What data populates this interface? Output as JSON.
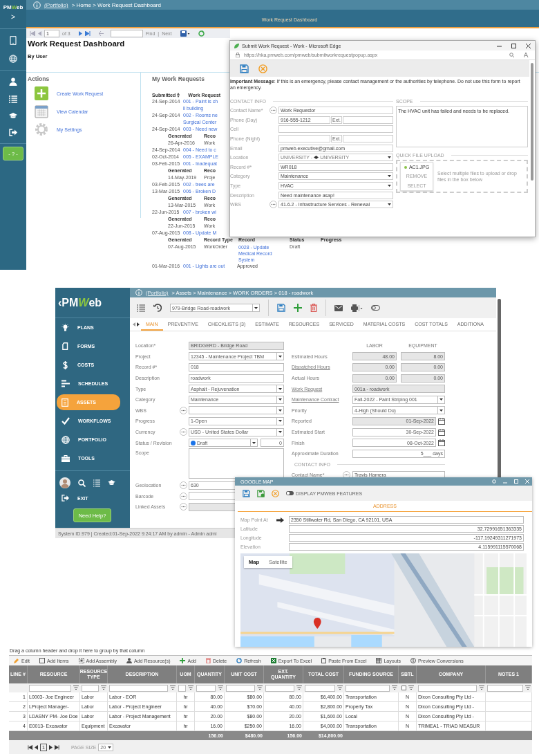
{
  "top": {
    "sidebar": {
      "logo": {
        "lead": "PM",
        "mark": "W",
        "tail": "eb"
      },
      "expand": ">",
      "help": "- ? -"
    },
    "breadcrumb": {
      "link": "(Portfolio)",
      "trail": "> Home > Work Request Dashboard"
    },
    "banner": "Work Request Dashboard",
    "report_toolbar": {
      "page": "1",
      "of": "of 3",
      "find": "Find",
      "separator": "|",
      "next": "Next"
    },
    "title": "Work Request Dashboard",
    "subtitle": "By User",
    "actions": {
      "title": "Actions",
      "items": [
        {
          "kind": "create",
          "label": "Create Work Request"
        },
        {
          "kind": "calendar",
          "label": "View Calendar"
        },
        {
          "kind": "settings",
          "label": "My Settings"
        }
      ]
    },
    "requests": {
      "title": "My Work Requests",
      "columns": [
        "Submitted",
        "Work Request"
      ],
      "rows": [
        {
          "kind": "request",
          "submitted": "24-Sep-2014",
          "lines": [
            "001 - Paint is ch",
            "ll building"
          ]
        },
        {
          "kind": "request",
          "submitted": "24-Sep-2014",
          "lines": [
            "002 - Rooms ne",
            "Surgical Center"
          ]
        },
        {
          "kind": "request",
          "submitted": "24-Sep-2014",
          "lines": [
            "003 - Need new"
          ]
        },
        {
          "kind": "generated",
          "columns": [
            "Generated",
            "Reco"
          ],
          "cells": [
            "26-Apr-2016",
            "Work"
          ]
        },
        {
          "kind": "request",
          "submitted": "24-Sep-2014",
          "lines": [
            "004 - Need to c"
          ]
        },
        {
          "kind": "request",
          "submitted": "02-Oct-2014",
          "lines": [
            "005 - EXAMPLE"
          ]
        },
        {
          "kind": "request",
          "submitted": "03-Feb-2015",
          "lines": [
            "001 - Inadequat"
          ]
        },
        {
          "kind": "generated",
          "columns": [
            "Generated",
            "Reco"
          ],
          "cells": [
            "14-May-2019",
            "Proje"
          ]
        },
        {
          "kind": "request",
          "submitted": "03-Feb-2015",
          "lines": [
            "002 - trees are"
          ]
        },
        {
          "kind": "request",
          "submitted": "13-Mar-2015",
          "lines": [
            "006 - Broken D"
          ]
        },
        {
          "kind": "generated",
          "columns": [
            "Generated",
            "Reco"
          ],
          "cells": [
            "13-Mar-2015",
            "Work"
          ]
        },
        {
          "kind": "request",
          "submitted": "22-Jun-2015",
          "lines": [
            "007 - broken wi"
          ]
        },
        {
          "kind": "generated",
          "columns": [
            "Generated",
            "Reco"
          ],
          "cells": [
            "22-Jun-2015",
            "Work"
          ]
        },
        {
          "kind": "request",
          "submitted": "07-Aug-2015",
          "lines": [
            "008 - Update M"
          ]
        },
        {
          "kind": "generated",
          "columns": [
            "Generated",
            "Record Type",
            "Record",
            "Status",
            "Progress"
          ],
          "cells": [
            "07-Aug-2015",
            "WorkOrder",
            "0028 - Update Medical Record System",
            "Draft"
          ]
        },
        {
          "kind": "request",
          "submitted": "01-Mar-2016",
          "lines": [
            "001 - Lights are out"
          ],
          "status": "Approved"
        }
      ]
    },
    "popup": {
      "title": "Submit Work Request - Work - Microsoft Edge",
      "url": "https://hka.pmweb.com/pmweb/submitworkrequestpopup.aspx",
      "message": "**Important Message**: If this is an emergency, please contact management or the authorities by telephone. Do not use this form to report an emergency.",
      "contact_title": "CONTACT INFO",
      "fields": [
        {
          "label": "Contact Name*",
          "kind": "text",
          "value": "Work Requestor",
          "picker": true
        },
        {
          "label": "Phone (Day)",
          "kind": "phone",
          "value": "916-555-1212",
          "ext": "Ext.",
          "picker": false
        },
        {
          "label": "Cell",
          "kind": "text",
          "picker": false
        },
        {
          "label": "Phone (Night)",
          "kind": "phone",
          "ext": "Ext.",
          "picker": false
        },
        {
          "label": "Email",
          "kind": "text",
          "value": "pmweb.executive@gmail.com",
          "picker": false
        },
        {
          "label": "Location",
          "kind": "location",
          "value": "UNIVERSITY -",
          "site": "UNIVERSITY",
          "picker": false
        },
        {
          "label": "Record #*",
          "kind": "text",
          "value": "WR018",
          "picker": false
        },
        {
          "label": "Category",
          "kind": "select",
          "value": "Maintenance",
          "picker": false
        },
        {
          "label": "Type",
          "kind": "select",
          "value": "HVAC",
          "picker": false
        },
        {
          "label": "Description",
          "kind": "text",
          "value": "Need maintenance asap!",
          "picker": false
        },
        {
          "label": "WBS",
          "kind": "select",
          "value": "41.6.2 - Infrastructure Services - Renewal",
          "picker": true
        }
      ],
      "scope_title": "SCOPE",
      "scope": "The HVAC unit has failed and needs to be replaced.",
      "upload_title": "QUICK FILE UPLOAD",
      "file": {
        "name": "AC1.JPG",
        "remove": "REMOVE",
        "select": "SELECT"
      },
      "drop_hint": "Select multiple files to upload or drop files in the box below"
    }
  },
  "middle": {
    "logo": {
      "back": "‹",
      "lead": "PM",
      "mark": "W",
      "tail": "eb"
    },
    "nav": [
      {
        "kind": "plans",
        "label": "PLANS",
        "selected": false
      },
      {
        "kind": "forms",
        "label": "FORMS",
        "selected": false
      },
      {
        "kind": "costs",
        "label": "COSTS",
        "selected": false
      },
      {
        "kind": "schedules",
        "label": "SCHEDULES",
        "selected": false
      },
      {
        "kind": "assets",
        "label": "ASSETS",
        "selected": true
      },
      {
        "kind": "workflows",
        "label": "WORKFLOWS",
        "selected": false
      },
      {
        "kind": "portfolio",
        "label": "PORTFOLIO",
        "selected": false
      },
      {
        "kind": "tools",
        "label": "TOOLS",
        "selected": false
      }
    ],
    "exit": "EXIT",
    "help": "Need Help?",
    "breadcrumb": {
      "link": "(Portfolio)",
      "trail": "> Assets > Maintenance > WORK ORDERS > 018 - roadwork"
    },
    "record": "979-Bridge Road-roadwork",
    "tabs": [
      {
        "label": "MAIN",
        "selected": true
      },
      {
        "label": "PREVENTIVE",
        "selected": false
      },
      {
        "label": "CHECKLISTS (3)",
        "selected": false
      },
      {
        "label": "ESTIMATE",
        "selected": false
      },
      {
        "label": "RESOURCES",
        "selected": false
      },
      {
        "label": "SERVICED",
        "selected": false
      },
      {
        "label": "MATERIAL COSTS",
        "selected": false
      },
      {
        "label": "COST TOTALS",
        "selected": false
      },
      {
        "label": "ADDITIONA",
        "selected": false
      }
    ],
    "left_fields": [
      {
        "label": "Location*",
        "kind": "text",
        "value": "BRIDGERD - Bridge Road",
        "readonly": true,
        "picker": false
      },
      {
        "label": "Project",
        "kind": "select",
        "value": "12345 - Maintenance Project TBM",
        "readonly": false,
        "picker": false
      },
      {
        "label": "Record #*",
        "kind": "text",
        "value": "018",
        "readonly": false,
        "picker": false
      },
      {
        "label": "Description",
        "kind": "text",
        "value": "roadwork",
        "readonly": false,
        "picker": false
      },
      {
        "label": "Type",
        "kind": "select",
        "value": "Asphalt - Rejuvenation",
        "readonly": false,
        "picker": false
      },
      {
        "label": "Category",
        "kind": "select",
        "value": "Maintenance",
        "readonly": false,
        "picker": false
      },
      {
        "label": "WBS",
        "kind": "select",
        "readonly": false,
        "picker": true
      },
      {
        "label": "Progress",
        "kind": "select",
        "value": "1-Open",
        "readonly": false,
        "picker": false
      },
      {
        "label": "Currency",
        "kind": "select",
        "value": "USD - United States Dollar",
        "readonly": false,
        "picker": true
      },
      {
        "label": "Status / Revision",
        "kind": "status",
        "value": "Draft",
        "revision": "0",
        "readonly": false,
        "picker": false
      },
      {
        "label": "Scope",
        "kind": "textarea",
        "readonly": false,
        "picker": false
      },
      {
        "label": "Geolocation",
        "kind": "text",
        "value": "630",
        "readonly": false,
        "picker": true
      },
      {
        "label": "Barcode",
        "kind": "text",
        "readonly": false,
        "picker": true
      },
      {
        "label": "Linked Assets",
        "kind": "text",
        "readonly": true,
        "picker": true
      }
    ],
    "right_header": [
      "LABOR",
      "EQUIPMENT"
    ],
    "right_fields": [
      {
        "label": "Estimated Hours",
        "kind": "pair",
        "values": [
          "48.00",
          "8.00"
        ],
        "link": false,
        "readonly": true,
        "picker": false
      },
      {
        "label": "Dispatched Hours",
        "kind": "pair",
        "values": [
          "0.00",
          "0.00"
        ],
        "link": true,
        "readonly": true,
        "picker": false
      },
      {
        "label": "Actual Hours",
        "kind": "pair",
        "values": [
          "0.00",
          "0.00"
        ],
        "link": false,
        "readonly": true,
        "picker": false
      },
      {
        "label": "Work Request",
        "kind": "text",
        "value": "001a - roadwork",
        "link": true,
        "readonly": true,
        "picker": false
      },
      {
        "label": "Maintenance Contract",
        "kind": "select",
        "value": "Fall-2022 - Paint Striping 001",
        "link": true,
        "readonly": false,
        "picker": false
      },
      {
        "label": "Priority",
        "kind": "select",
        "value": "4-High (Should Do)",
        "link": false,
        "readonly": false,
        "picker": false
      },
      {
        "label": "Reported",
        "kind": "date",
        "value": "01-Sep-2022",
        "link": false,
        "readonly": true,
        "picker": false
      },
      {
        "label": "Estimated Start",
        "kind": "date",
        "value": "30-Sep-2022",
        "link": false,
        "readonly": false,
        "picker": false
      },
      {
        "label": "Finish",
        "kind": "date",
        "value": "08-Oct-2022",
        "link": false,
        "readonly": false,
        "picker": false
      },
      {
        "label": "Approximate Duration",
        "kind": "duration",
        "value": "5___ days",
        "link": false,
        "readonly": false,
        "picker": false
      },
      {
        "label": "CONTACT INFO",
        "kind": "section"
      },
      {
        "label": "Contact Name*",
        "kind": "text",
        "value": "Travis Hamera",
        "link": false,
        "readonly": false,
        "picker": true
      }
    ],
    "status_bar": "System ID:979 | Created:01-Sep-2022 9:24:17 AM by admin - Admin admi"
  },
  "map": {
    "title": "GOOGLE MAP",
    "toggle": {
      "label": "DISPLAY PMWEB FEATURES",
      "on": false
    },
    "tabs": [
      {
        "label": "ADDRESS",
        "selected": true
      }
    ],
    "fields": [
      {
        "label": "Map Point At",
        "kind": "address",
        "value": "2350 Stillwater Rd, San Diego, CA 92101, USA"
      },
      {
        "label": "Latitude",
        "kind": "number",
        "value": "32.72991651363335"
      },
      {
        "label": "Longitude",
        "kind": "number",
        "value": "-117.19249311271973"
      },
      {
        "label": "Elevation",
        "kind": "number",
        "value": "4.115991115570068"
      }
    ],
    "map_types": [
      {
        "label": "Map",
        "selected": true
      },
      {
        "label": "Satellite",
        "selected": false
      }
    ]
  },
  "resources": {
    "hint": "Drag a column header and drop it here to group by that column",
    "toolbar": [
      {
        "kind": "edit",
        "label": "Edit"
      },
      {
        "kind": "items",
        "label": "Add Items"
      },
      {
        "kind": "assembly",
        "label": "Add Assembly"
      },
      {
        "kind": "resource",
        "label": "Add Resource(s)"
      },
      {
        "kind": "add",
        "label": "Add"
      },
      {
        "kind": "delete",
        "label": "Delete"
      },
      {
        "kind": "refresh",
        "label": "Refresh"
      },
      {
        "kind": "excel",
        "label": "Export To Excel"
      },
      {
        "kind": "paste",
        "label": "Paste From Excel"
      },
      {
        "kind": "layouts",
        "label": "Layouts"
      },
      {
        "kind": "preview",
        "label": "Preview Conversions"
      }
    ],
    "columns": [
      "LINE #",
      "RESOURCE",
      "RESOURCE TYPE",
      "DESCRIPTION",
      "UOM",
      "QUANTITY",
      "UNIT COST",
      "EXT. QUANTITY",
      "TOTAL COST",
      "FUNDING SOURCE",
      "SBTL",
      "COMPANY",
      "NOTES 1"
    ],
    "sbtl_filter": {
      "checked": false
    },
    "rows": [
      [
        "1",
        "L0003- Joe Engineer",
        "Labor",
        "Labor - EOR",
        "hr",
        "80.00",
        "$80.00",
        "80.00",
        "$6,400.00",
        "Transportation",
        "N",
        "Dixon Consulting Pty Ltd -"
      ],
      [
        "2",
        "LProject Manager-",
        "Labor",
        "Labor - Project Engineer",
        "hr",
        "40.00",
        "$70.00",
        "40.00",
        "$2,800.00",
        "Property Tax",
        "N",
        "Dixon Consulting Pty Ltd -"
      ],
      [
        "3",
        "LDASNY PM- Joe Doe",
        "Labor",
        "Labor - Project Management",
        "hr",
        "20.00",
        "$80.00",
        "20.00",
        "$1,600.00",
        "Local",
        "N",
        "Dixon Consulting Pty Ltd -"
      ],
      [
        "4",
        "E0013- Excavator",
        "Equipment",
        "Excavator",
        "hr",
        "16.00",
        "$250.00",
        "16.00",
        "$4,000.00",
        "Transportation",
        "N",
        "TRIMEA1 - TRIAD MEASUR"
      ]
    ],
    "totals": {
      "quantity": "156.00",
      "unit_cost": "$480.00",
      "ext_quantity": "156.00",
      "total_cost": "$14,800.00"
    },
    "pager": {
      "page": "1",
      "size_label": "PAGE SIZE",
      "size": "20"
    }
  }
}
